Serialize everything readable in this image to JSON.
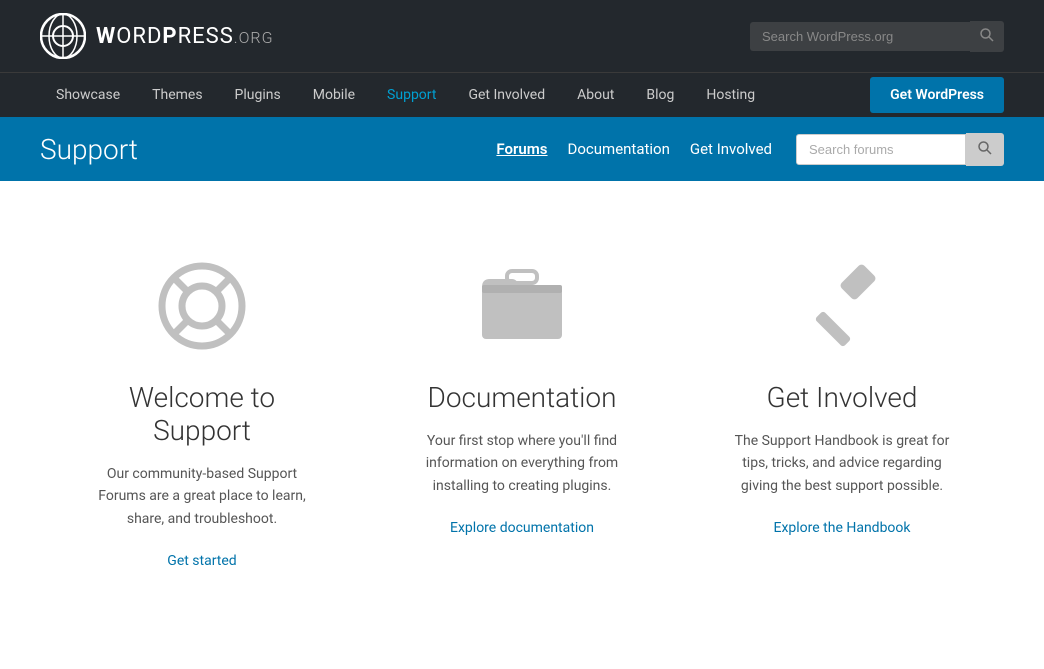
{
  "topbar": {
    "logo_text": "WordPress",
    "logo_org": ".org",
    "search_placeholder": "Search WordPress.org"
  },
  "main_nav": {
    "items": [
      {
        "label": "Showcase",
        "href": "#",
        "active": false
      },
      {
        "label": "Themes",
        "href": "#",
        "active": false
      },
      {
        "label": "Plugins",
        "href": "#",
        "active": false
      },
      {
        "label": "Mobile",
        "href": "#",
        "active": false
      },
      {
        "label": "Support",
        "href": "#",
        "active": true
      },
      {
        "label": "Get Involved",
        "href": "#",
        "active": false
      },
      {
        "label": "About",
        "href": "#",
        "active": false
      },
      {
        "label": "Blog",
        "href": "#",
        "active": false
      },
      {
        "label": "Hosting",
        "href": "#",
        "active": false
      }
    ],
    "get_wordpress_label": "Get WordPress"
  },
  "support_bar": {
    "title": "Support",
    "nav_items": [
      {
        "label": "Forums",
        "active": true
      },
      {
        "label": "Documentation",
        "active": false
      },
      {
        "label": "Get Involved",
        "active": false
      }
    ],
    "search_placeholder": "Search forums"
  },
  "features": [
    {
      "icon": "lifesaver",
      "title": "Welcome to Support",
      "description": "Our community-based Support Forums are a great place to learn, share, and troubleshoot.",
      "link_text": "Get started",
      "link_href": "#"
    },
    {
      "icon": "folder",
      "title": "Documentation",
      "description": "Your first stop where you'll find information on everything from installing to creating plugins.",
      "link_text": "Explore documentation",
      "link_href": "#"
    },
    {
      "icon": "hammer",
      "title": "Get Involved",
      "description": "The Support Handbook is great for tips, tricks, and advice regarding giving the best support possible.",
      "link_text": "Explore the Handbook",
      "link_href": "#"
    }
  ]
}
